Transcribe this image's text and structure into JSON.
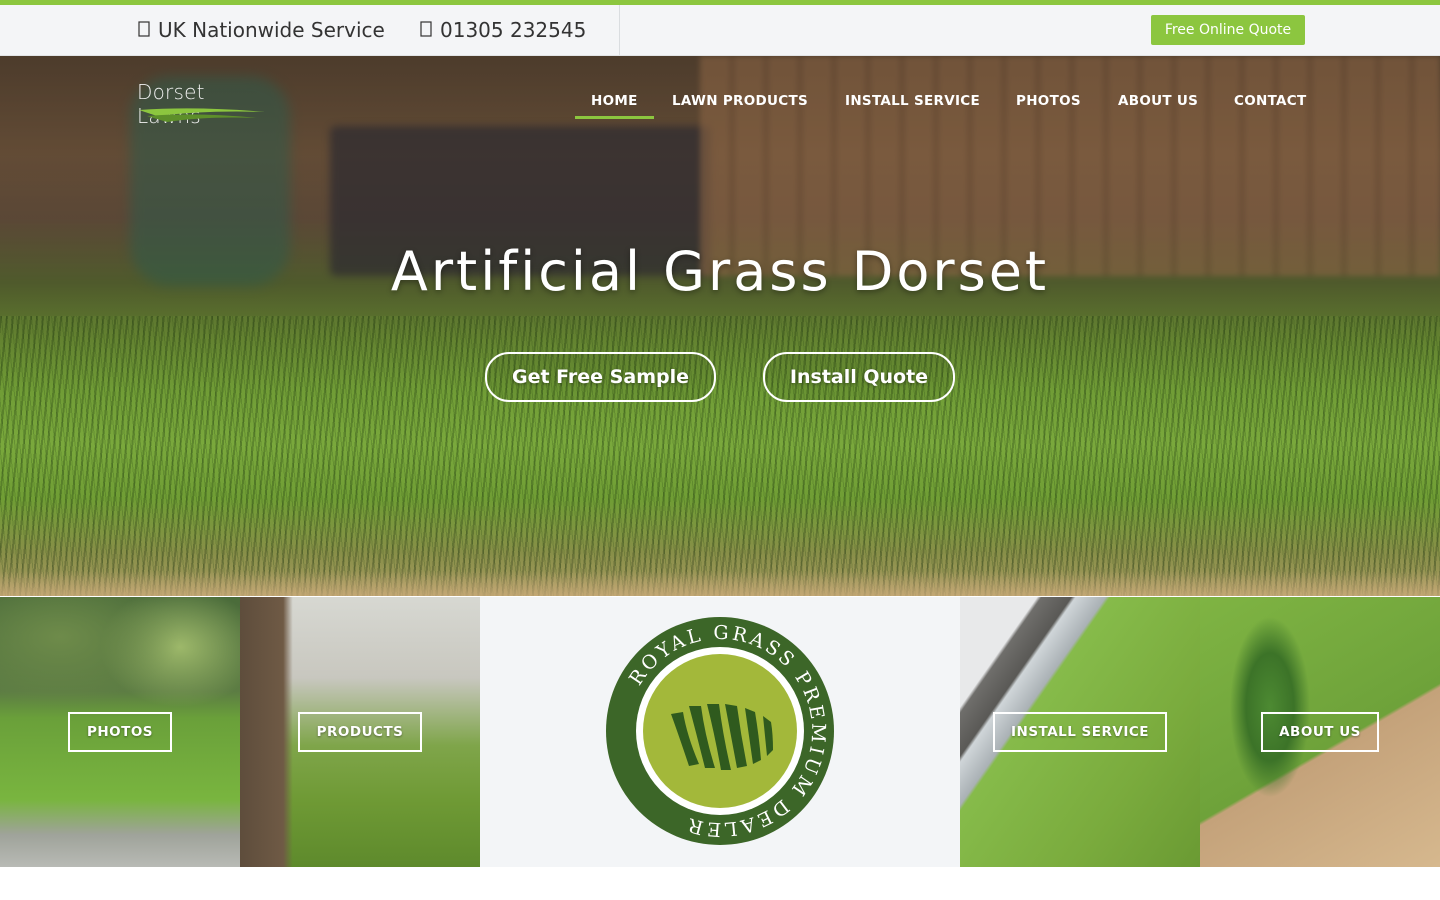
{
  "topbar": {
    "service_icon": "map-marker-icon",
    "service_text": "UK Nationwide Service",
    "phone_icon": "phone-icon",
    "phone_text": "01305 232545",
    "quote_label": "Free Online Quote"
  },
  "brand": {
    "name": "Dorset Lawns",
    "accent_color": "#8cc63f"
  },
  "nav": {
    "items": [
      {
        "label": "HOME",
        "active": true
      },
      {
        "label": "LAWN PRODUCTS",
        "active": false
      },
      {
        "label": "INSTALL SERVICE",
        "active": false
      },
      {
        "label": "PHOTOS",
        "active": false
      },
      {
        "label": "ABOUT US",
        "active": false
      },
      {
        "label": "CONTACT",
        "active": false
      }
    ]
  },
  "hero": {
    "title": "Artificial Grass Dorset",
    "buttons": [
      "Get Free Sample",
      "Install Quote"
    ]
  },
  "tiles": {
    "photos_label": "PHOTOS",
    "products_label": "PRODUCTS",
    "badge_text": "ROYAL GRASS PREMIUM DEALER",
    "install_label": "INSTALL SERVICE",
    "about_label": "ABOUT US"
  }
}
